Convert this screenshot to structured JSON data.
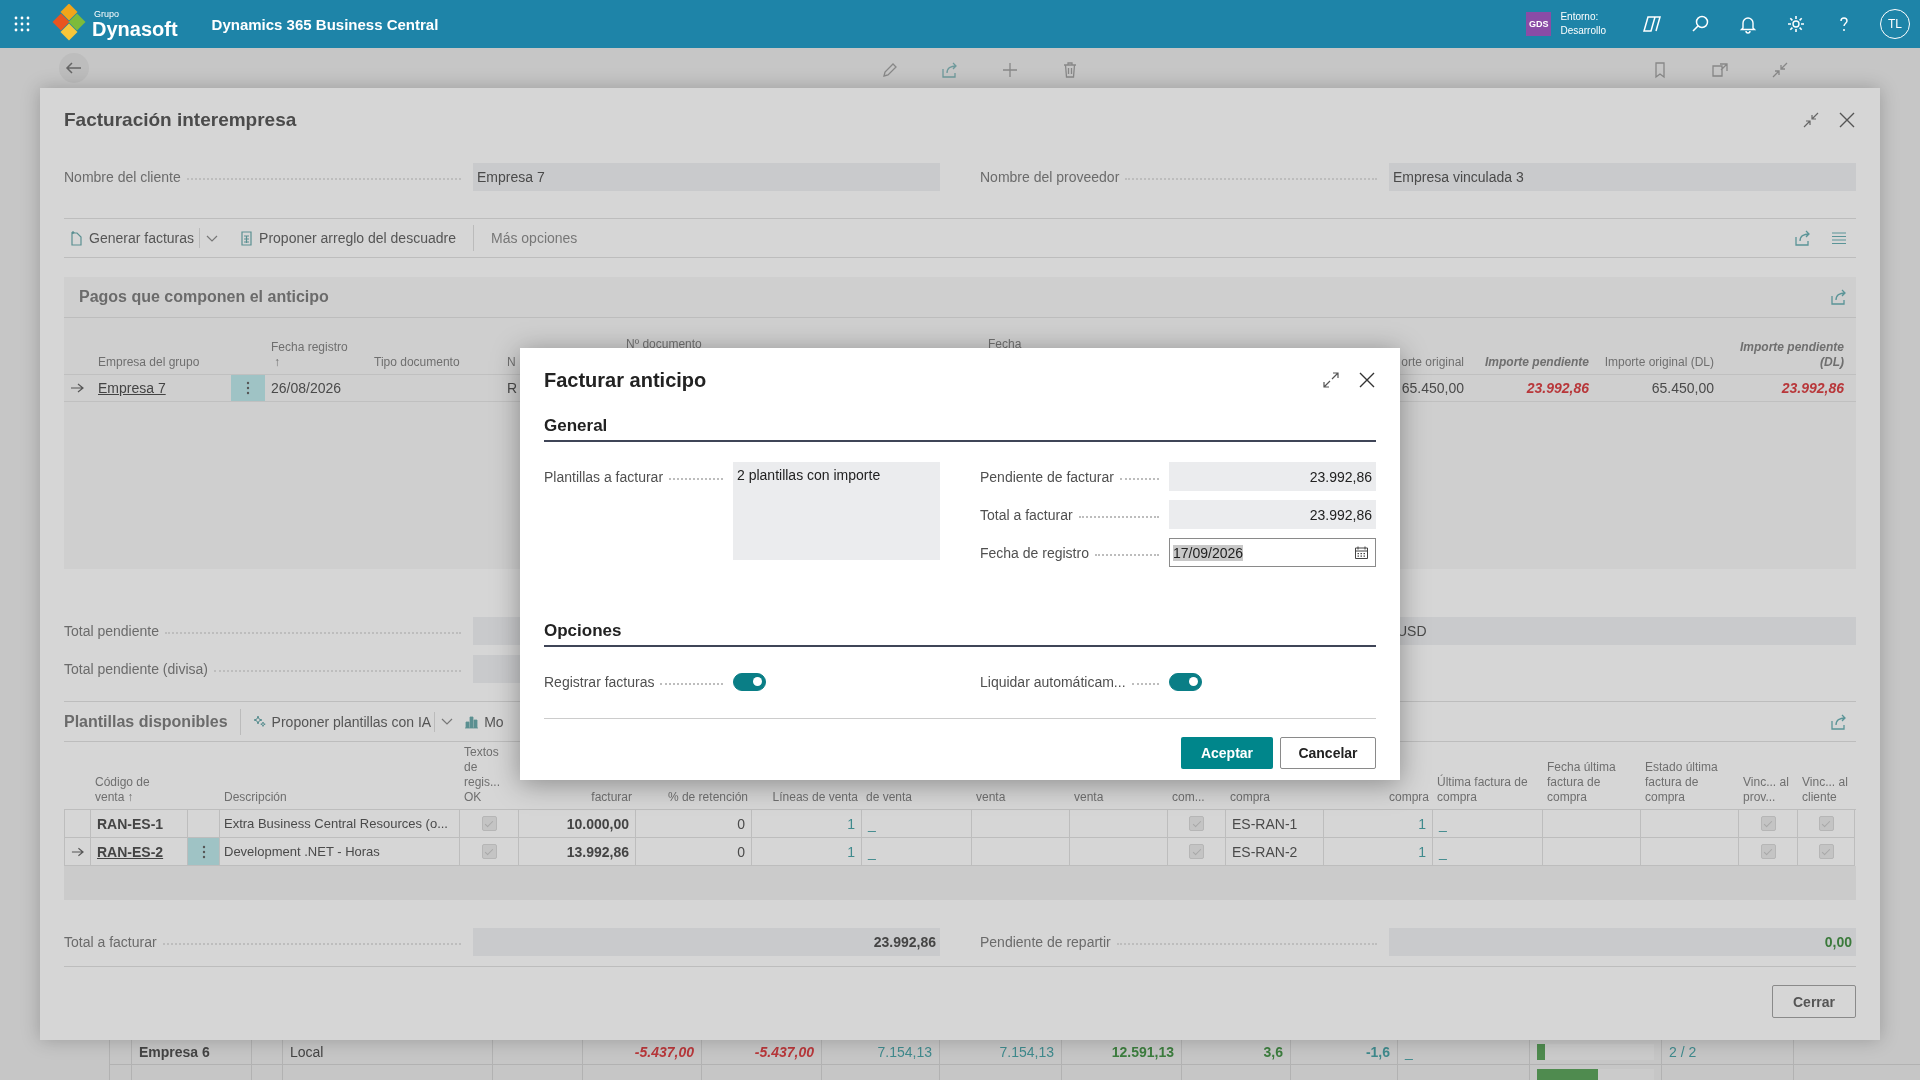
{
  "app_bar": {
    "group_label": "Grupo",
    "logo_text": "Dynasoft",
    "product": "Dynamics 365 Business Central",
    "environment_badge": "GDS",
    "environment_label": "Entorno:",
    "environment_name": "Desarrollo",
    "avatar": "TL"
  },
  "background_table": {
    "rows": [
      {
        "name": "Empresa 6",
        "type": "Local",
        "amount_1": "-5.437,00",
        "amount_2": "-5.437,00",
        "amount_3": "7.154,13",
        "amount_4": "7.154,13",
        "amount_5": "12.591,13",
        "value_1": "3,6",
        "value_2": "-1,6",
        "last_invoice": "_",
        "level": 0.07,
        "ratio": "2 / 2"
      },
      {
        "level": 0.52
      }
    ]
  },
  "dialog": {
    "title": "Facturación interempresa",
    "header_fields": [
      {
        "label": "Nombre del cliente",
        "value": "Empresa 7"
      },
      {
        "label": "Nombre del proveedor",
        "value": "Empresa vinculada 3"
      }
    ],
    "actions": [
      {
        "label": "Generar facturas",
        "kind": "split"
      },
      {
        "label": "Proponer arreglo del descuadre",
        "kind": "plain"
      },
      {
        "label": "Más opciones",
        "kind": "more"
      }
    ],
    "payments": {
      "title": "Pagos que componen el anticipo",
      "columns": [
        {
          "label": "Empresa del grupo"
        },
        {
          "label": "Fecha registro",
          "sort": "↑"
        },
        {
          "label": "Tipo documento"
        },
        {
          "label": "N"
        },
        {
          "label": "Nº documento"
        },
        {
          "label": "Fecha"
        },
        {
          "label": "orte original"
        },
        {
          "label": "Importe pendiente"
        },
        {
          "label": "Importe original (DL)"
        },
        {
          "label": "Importe pendiente (DL)"
        }
      ],
      "rows": [
        {
          "selected": true,
          "company": "Empresa 7",
          "posting_date": "26/08/2026",
          "column_4": "R",
          "original_amount": "65.450,00",
          "pending_amount": "23.992,86",
          "original_amount_dl": "65.450,00",
          "pending_amount_dl": "23.992,86"
        }
      ]
    },
    "totals": [
      {
        "label": "Total pendiente"
      },
      {
        "label": "Total pendiente (divisa)"
      }
    ],
    "currency": "USD",
    "templates": {
      "title": "Plantillas disponibles",
      "actions": [
        {
          "label": "Proponer plantillas con IA",
          "kind": "split"
        },
        {
          "label": "Mo",
          "kind": "chart"
        }
      ],
      "columns": [
        {
          "label": "Código de venta",
          "sort": "↑"
        },
        {
          "label": "Descripción"
        },
        {
          "label": "Textos de regis... OK"
        },
        {
          "label": "facturar"
        },
        {
          "label": "% de retención"
        },
        {
          "label": "Líneas de venta"
        },
        {
          "label": "de venta"
        },
        {
          "label": "venta"
        },
        {
          "label": "venta"
        },
        {
          "label": "com..."
        },
        {
          "label": "compra"
        },
        {
          "label": "compra"
        },
        {
          "label": "Última factura de compra"
        },
        {
          "label": "Fecha última factura de compra"
        },
        {
          "label": "Estado última factura de compra"
        },
        {
          "label": "Vinc... al prov..."
        },
        {
          "label": "Vinc... al cliente"
        }
      ],
      "rows": [
        {
          "selected": false,
          "code": "RAN-ES-1",
          "description": "Extra Business Central Resources (o...",
          "posting_texts_ok": true,
          "amount": "10.000,00",
          "retention": "0",
          "sales_lines": "1",
          "last_sales_invoice": "_",
          "purchase_check": true,
          "purchase_code": "ES-RAN-1",
          "purchase_lines": "1",
          "last_purchase_invoice": "_",
          "linked_vendor": true,
          "linked_customer": true
        },
        {
          "selected": true,
          "code": "RAN-ES-2",
          "description": "Development .NET - Horas",
          "posting_texts_ok": true,
          "amount": "13.992,86",
          "retention": "0",
          "sales_lines": "1",
          "last_sales_invoice": "_",
          "purchase_check": true,
          "purchase_code": "ES-RAN-2",
          "purchase_lines": "1",
          "last_purchase_invoice": "_",
          "linked_vendor": true,
          "linked_customer": true
        }
      ]
    },
    "footer_totals": [
      {
        "label": "Total a facturar",
        "value": "23.992,86"
      },
      {
        "label": "Pendiente de repartir",
        "value": "0,00"
      }
    ],
    "close_button": "Cerrar"
  },
  "modal": {
    "title": "Facturar anticipo",
    "general_heading": "General",
    "templates_label": "Plantillas a facturar",
    "templates_value": "2 plantillas con importe",
    "fields": [
      {
        "label": "Pendiente de facturar",
        "value": "23.992,86",
        "kind": "readonly"
      },
      {
        "label": "Total a facturar",
        "value": "23.992,86",
        "kind": "readonly"
      },
      {
        "label": "Fecha de registro",
        "value": "17/09/2026",
        "kind": "date",
        "value_selected": true
      }
    ],
    "options_heading": "Opciones",
    "options": [
      {
        "label": "Registrar facturas",
        "on": true
      },
      {
        "label": "Liquidar automáticam...",
        "on": true
      }
    ],
    "buttons": [
      {
        "label": "Aceptar",
        "kind": "primary"
      },
      {
        "label": "Cancelar",
        "kind": "secondary"
      }
    ]
  }
}
